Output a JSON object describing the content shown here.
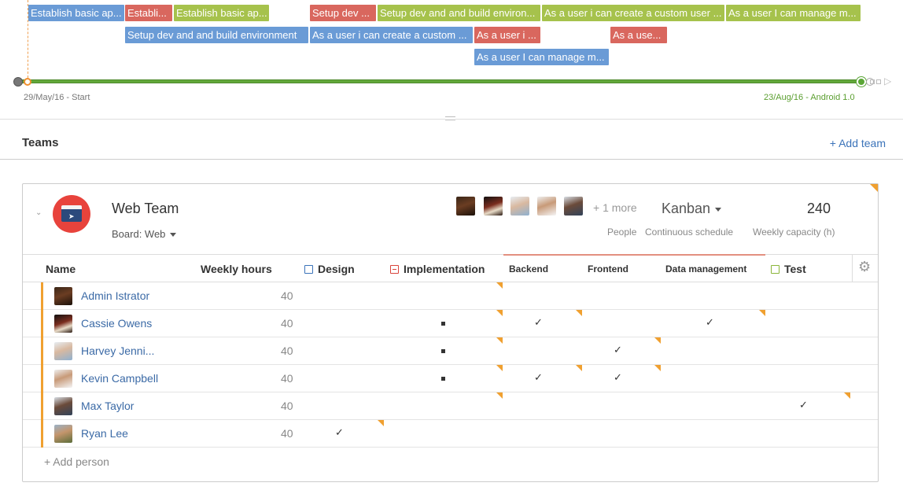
{
  "timeline": {
    "issues": [
      {
        "label": "Establish basic ap...",
        "color": "blue"
      },
      {
        "label": "Establi...",
        "color": "red"
      },
      {
        "label": "Establish basic ap...",
        "color": "green"
      },
      {
        "label": "Setup dev ...",
        "color": "red"
      },
      {
        "label": "Setup dev and and build environ...",
        "color": "green"
      },
      {
        "label": "As a user i can create a custom user ...",
        "color": "green"
      },
      {
        "label": "As a user I can manage m...",
        "color": "green"
      },
      {
        "label": "Setup dev and and build environment",
        "color": "blue"
      },
      {
        "label": "As a user i can create a custom ...",
        "color": "blue"
      },
      {
        "label": "As a user i ...",
        "color": "red"
      },
      {
        "label": "As a use...",
        "color": "red"
      },
      {
        "label": "As a user I can manage m...",
        "color": "blue"
      }
    ],
    "start_label": "29/May/16 - Start",
    "end_label": "23/Aug/16 - Android 1.0"
  },
  "teams": {
    "title": "Teams",
    "add_team": "+ Add team"
  },
  "team": {
    "name": "Web Team",
    "board": "Board: Web",
    "more_people": "+ 1 more",
    "people_label": "People",
    "schedule": "Kanban",
    "schedule_label": "Continuous schedule",
    "capacity": "240",
    "capacity_label": "Weekly capacity (h)"
  },
  "table": {
    "headers": {
      "name": "Name",
      "hours": "Weekly hours",
      "design": "Design",
      "implementation": "Implementation",
      "backend": "Backend",
      "frontend": "Frontend",
      "data_management": "Data management",
      "test": "Test"
    },
    "rows": [
      {
        "name": "Admin Istrator",
        "hours": "40",
        "design": false,
        "implementation": false,
        "backend": false,
        "frontend": false,
        "data_management": false,
        "test": false
      },
      {
        "name": "Cassie Owens",
        "hours": "40",
        "design": false,
        "implementation": true,
        "backend": true,
        "frontend": false,
        "data_management": true,
        "test": false
      },
      {
        "name": "Harvey Jenni...",
        "hours": "40",
        "design": false,
        "implementation": true,
        "backend": false,
        "frontend": true,
        "data_management": false,
        "test": false
      },
      {
        "name": "Kevin Campbell",
        "hours": "40",
        "design": false,
        "implementation": true,
        "backend": true,
        "frontend": true,
        "data_management": false,
        "test": false
      },
      {
        "name": "Max Taylor",
        "hours": "40",
        "design": false,
        "implementation": false,
        "backend": false,
        "frontend": false,
        "data_management": false,
        "test": true
      },
      {
        "name": "Ryan Lee",
        "hours": "40",
        "design": true,
        "implementation": false,
        "backend": false,
        "frontend": false,
        "data_management": false,
        "test": false
      }
    ],
    "add_person": "+ Add person",
    "check_glyph": "✓"
  },
  "colors": {
    "blue": "#6a9bd6",
    "red": "#d9675e",
    "green": "#a6c24c",
    "accent": "#3b73b9",
    "warning": "#f0a030"
  }
}
